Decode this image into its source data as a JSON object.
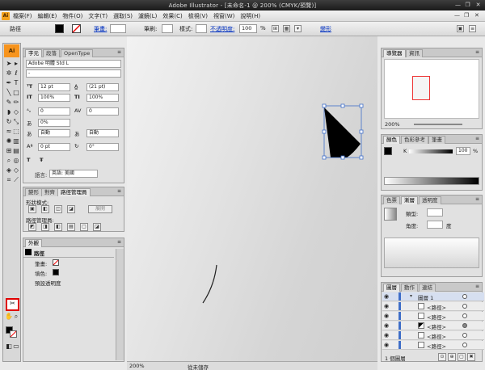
{
  "window": {
    "title": "Adobe Illustrator - [未命名-1 @ 200% (CMYK/預覽)]",
    "controls": [
      "—",
      "❐",
      "✕"
    ]
  },
  "menubar": {
    "logo": "Ai",
    "items": [
      "檔案(F)",
      "編輯(E)",
      "物件(O)",
      "文字(T)",
      "選取(S)",
      "濾鏡(L)",
      "效果(C)",
      "檢視(V)",
      "視窗(W)",
      "說明(H)"
    ],
    "right_controls": [
      "—",
      "❐",
      "✕"
    ]
  },
  "controlbar": {
    "object_label": "路徑",
    "stroke_label": "筆畫:",
    "brush_label": "筆刷:",
    "style_label": "樣式:",
    "opacity_label": "不透明度:",
    "opacity_value": "100",
    "opacity_unit": "%",
    "transform_label": "變形"
  },
  "toolbox": {
    "logo": "Ai",
    "tools": [
      "select-tool",
      "direct-select-tool",
      "magic-wand-tool",
      "lasso-tool",
      "pen-tool",
      "type-tool",
      "line-tool",
      "rectangle-tool",
      "paintbrush-tool",
      "pencil-tool",
      "blob-brush-tool",
      "eraser-tool",
      "rotate-tool",
      "scale-tool",
      "warp-tool",
      "free-transform-tool",
      "symbol-sprayer-tool",
      "column-graph-tool",
      "mesh-tool",
      "gradient-tool",
      "eyedropper-tool",
      "blend-tool",
      "live-paint-tool",
      "live-paint-select-tool",
      "crop-area-tool",
      "slice-tool",
      "scissors-tool",
      "hand-tool",
      "zoom-tool"
    ],
    "selected_tool": "scissors-tool"
  },
  "character_panel": {
    "tabs": [
      "字元",
      "段落",
      "OpenType"
    ],
    "font_family": "Adobe 明體 Std L",
    "font_style": "-",
    "font_size": "12 pt",
    "leading": "(21 pt)",
    "vertical_scale": "100%",
    "horizontal_scale": "100%",
    "kerning": "0",
    "tracking": "0",
    "tsume": "0%",
    "aki_left": "自動",
    "aki_right": "自動",
    "baseline_shift": "0 pt",
    "rotation": "0°",
    "language_label": "語言:",
    "language_value": "英語: 美國",
    "text_buttons": [
      "T",
      "Ŧ"
    ]
  },
  "pathfinder_panel": {
    "tabs": [
      "變形",
      "對齊",
      "路徑管理員"
    ],
    "shape_modes_label": "形狀模式:",
    "pathfinders_label": "路徑管理員:",
    "expand_label": "展開"
  },
  "appearance_panel": {
    "tabs": [
      "外觀"
    ],
    "header": "路徑",
    "rows": [
      {
        "label": "筆畫:",
        "icon": "stroke-none-swatch"
      },
      {
        "label": "填色:",
        "icon": "fill-black-swatch"
      },
      {
        "label": "預設透明度",
        "icon": ""
      }
    ]
  },
  "navigator_panel": {
    "tabs": [
      "導覽器",
      "資訊"
    ],
    "zoom": "200%"
  },
  "color_panel": {
    "tabs": [
      "顏色",
      "色彩參考",
      "筆畫"
    ],
    "channel_label": "K",
    "channel_value": "100",
    "unit": "%"
  },
  "gradient_panel": {
    "tabs": [
      "色票",
      "漸層",
      "透明度"
    ],
    "type_label": "類型:",
    "angle_label": "角度:",
    "angle_unit": "度"
  },
  "layers_panel": {
    "tabs": [
      "圖層",
      "動作",
      "連結"
    ],
    "rows": [
      {
        "name": "圖層 1",
        "type": "layer"
      },
      {
        "name": "<路徑>",
        "type": "path"
      },
      {
        "name": "<路徑>",
        "type": "path"
      },
      {
        "name": "<路徑>",
        "type": "path-black"
      },
      {
        "name": "<路徑>",
        "type": "path"
      },
      {
        "name": "<路徑>",
        "type": "path"
      }
    ],
    "footer": "1 個圖層"
  },
  "statusbar": {
    "zoom": "200%",
    "status": "從未儲存"
  },
  "colors": {
    "selection_blue": "#3f6ec8",
    "tool_highlight": "#e00000",
    "logo_orange": "#f7941d"
  }
}
